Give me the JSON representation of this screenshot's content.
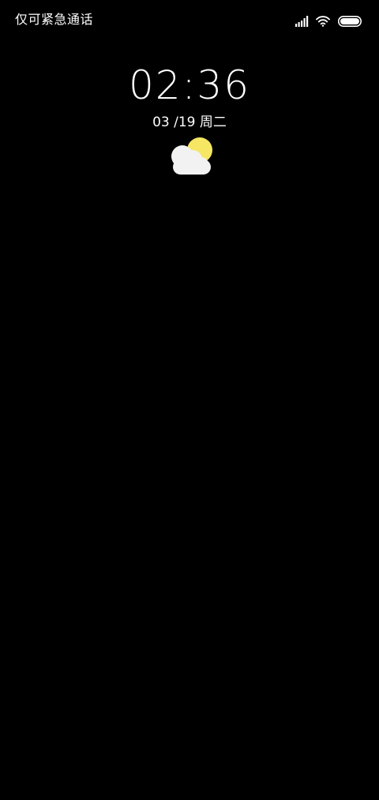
{
  "status_bar": {
    "carrier_text": "仅可紧急通话",
    "signal_icon": "signal-icon",
    "wifi_icon": "wifi-icon",
    "battery_icon": "battery-icon"
  },
  "lockscreen": {
    "time": "02:36",
    "date": "03 /19 周二",
    "weather_icon": "partly-cloudy-icon"
  },
  "colors": {
    "background": "#000000",
    "text": "#ffffff",
    "sun": "#f5e663",
    "cloud": "#f2f2f2"
  }
}
